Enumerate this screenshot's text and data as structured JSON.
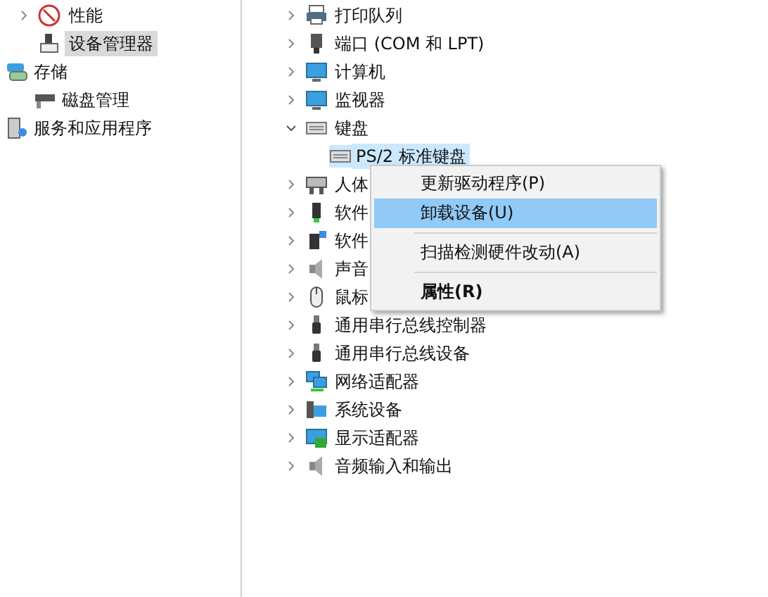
{
  "sidebar": {
    "partial_children": [
      {
        "label": "性能",
        "expanded": false,
        "selected": false
      },
      {
        "label": "设备管理器",
        "selected": true
      }
    ],
    "items": [
      {
        "label": "存储",
        "selected": false,
        "children": [
          {
            "label": "磁盘管理",
            "selected": false
          }
        ]
      },
      {
        "label": "服务和应用程序",
        "selected": false
      }
    ]
  },
  "device_tree": [
    {
      "label": "打印队列",
      "expanded": false
    },
    {
      "label": "端口 (COM 和 LPT)",
      "expanded": false
    },
    {
      "label": "计算机",
      "expanded": false
    },
    {
      "label": "监视器",
      "expanded": false
    },
    {
      "label": "键盘",
      "expanded": true,
      "children": [
        {
          "label": "PS/2 标准键盘",
          "selected": true
        }
      ]
    },
    {
      "label": "人体",
      "expanded": false
    },
    {
      "label": "软件",
      "expanded": false
    },
    {
      "label": "软件",
      "expanded": false
    },
    {
      "label": "声音",
      "expanded": false
    },
    {
      "label": "鼠标",
      "expanded": false
    },
    {
      "label": "通用串行总线控制器",
      "expanded": false
    },
    {
      "label": "通用串行总线设备",
      "expanded": false
    },
    {
      "label": "网络适配器",
      "expanded": false
    },
    {
      "label": "系统设备",
      "expanded": false
    },
    {
      "label": "显示适配器",
      "expanded": false
    },
    {
      "label": "音频输入和输出",
      "expanded": false
    }
  ],
  "context_menu": [
    {
      "kind": "item",
      "label": "更新驱动程序(P)",
      "selected": false,
      "default": false
    },
    {
      "kind": "item",
      "label": "卸载设备(U)",
      "selected": true,
      "default": false
    },
    {
      "kind": "separator"
    },
    {
      "kind": "item",
      "label": "扫描检测硬件改动(A)",
      "selected": false,
      "default": false
    },
    {
      "kind": "separator"
    },
    {
      "kind": "item",
      "label": "属性(R)",
      "selected": false,
      "default": true
    }
  ]
}
